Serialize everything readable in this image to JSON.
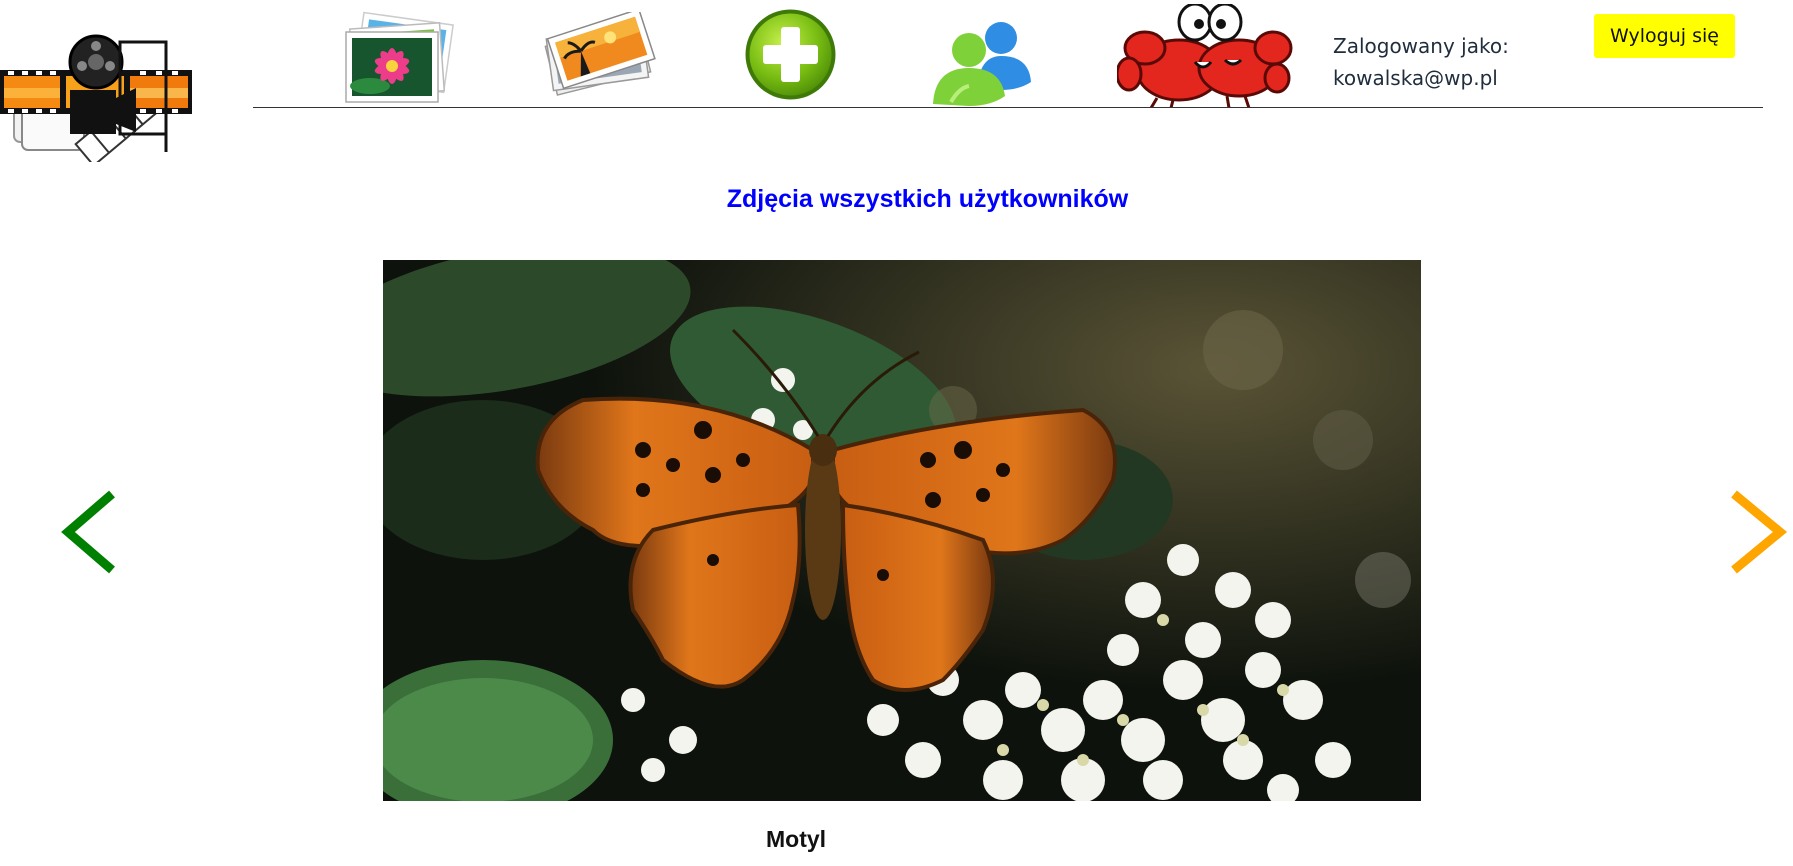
{
  "header": {
    "logo_icon": "film-projector-logo-icon",
    "nav": [
      {
        "name": "gallery-icon",
        "title": "Galeria"
      },
      {
        "name": "photos-icon",
        "title": "Zdjęcia"
      },
      {
        "name": "add-icon",
        "title": "Dodaj"
      },
      {
        "name": "users-icon",
        "title": "Użytkownicy"
      },
      {
        "name": "crabs-icon",
        "title": "Kraby"
      }
    ],
    "user_label": "Zalogowany jako:",
    "user_email": "kowalska@wp.pl",
    "logout_label": "Wyloguj się"
  },
  "main": {
    "title": "Zdjęcia wszystkich użytkowników",
    "photo_alt": "Motyl",
    "caption": "Motyl",
    "prev_icon": "chevron-left-icon",
    "next_icon": "chevron-right-icon"
  },
  "colors": {
    "title": "#0000ff",
    "logout_bg": "#ffff00",
    "prev_arrow": "#008000",
    "next_arrow": "#ffa500",
    "user_text": "#1f2d3d"
  }
}
